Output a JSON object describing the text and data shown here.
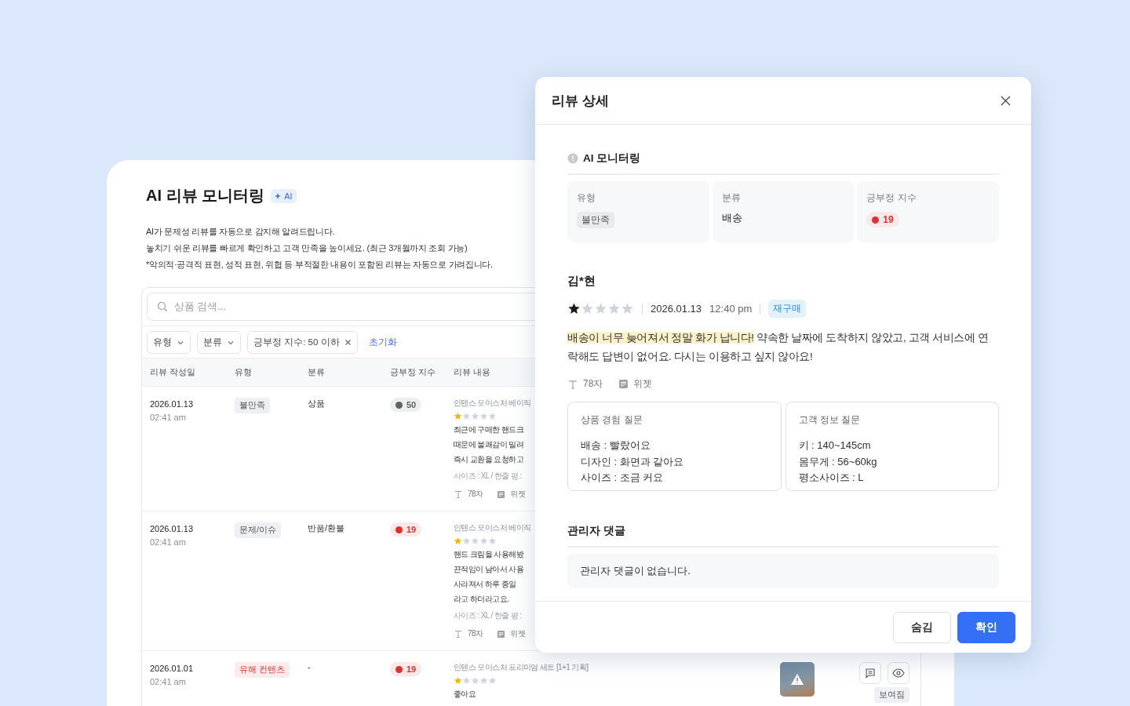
{
  "page": {
    "title": "AI 리뷰 모니터링",
    "badge": "AI",
    "description": [
      "AI가 문제성 리뷰를 자동으로 감지해 알려드립니다.",
      "놓치기 쉬운 리뷰를 빠르게 확인하고 고객 만족을 높이세요. (최근 3개월까지 조회 가능)",
      "*악의적·공격적 표현, 성적 표현, 위협 등 부적절한 내용이 포함된 리뷰는 자동으로 가려집니다."
    ]
  },
  "search": {
    "placeholder": "상품 검색..."
  },
  "filters": [
    {
      "kind": "dropdown",
      "label": "유형"
    },
    {
      "kind": "dropdown",
      "label": "분류"
    },
    {
      "kind": "chip",
      "label": "긍부정 지수: 50 이하"
    }
  ],
  "reset": "초기화",
  "table": {
    "columns": [
      "리뷰 작성일",
      "유형",
      "분류",
      "긍부정 지수",
      "리뷰 내용"
    ],
    "rows": [
      {
        "date": "2026.01.13",
        "time": "02:41 am",
        "type": {
          "label": "불만족",
          "kind": "neutral"
        },
        "category": "상품",
        "score": {
          "value": "50",
          "color": "#5f6368"
        },
        "product": "인텐스 모이스처 베이직",
        "stars": 1,
        "lines": [
          "최근에 구매한 핸드크",
          "때문에 불쾌감이 밀려",
          "즉시 교환을 요청하고"
        ],
        "option": "사이즈 : XL / 한줄 평 :",
        "length": "78자",
        "widget": "위젯"
      },
      {
        "date": "2026.01.13",
        "time": "02:41 am",
        "type": {
          "label": "문제/이슈",
          "kind": "neutral"
        },
        "category": "반품/환불",
        "score": {
          "value": "19",
          "color": "#e03131"
        },
        "product": "인텐스 모이스처 베이직",
        "stars": 1,
        "lines": [
          "핸드 크림을 사용해봤",
          "끈적임이 남아서 사용",
          "사라져서 하루 종일",
          "라고 하더라고요."
        ],
        "option": "사이즈 : XL / 한줄 평 :",
        "length": "78자",
        "widget": "위젯"
      },
      {
        "date": "2026.01.01",
        "time": "02:41 am",
        "type": {
          "label": "유해 컨텐츠",
          "kind": "harmful"
        },
        "category": "-",
        "score": {
          "value": "19",
          "color": "#e03131"
        },
        "product": "인텐스 모이스처 프리미엄 세트 [1+1 기획]",
        "stars": 1,
        "lines": [
          "좋아요"
        ],
        "status": "보여짐"
      }
    ]
  },
  "modal": {
    "title": "리뷰 상세",
    "section": "AI 모니터링",
    "cells": [
      {
        "kind": "tag",
        "label": "유형",
        "value": "불만족"
      },
      {
        "kind": "text",
        "label": "분류",
        "value": "배송"
      },
      {
        "kind": "score",
        "label": "긍부정 지수",
        "value": "19",
        "color": "#e03131"
      }
    ],
    "reviewer": "김*현",
    "stars": 1,
    "date": "2026.01.13",
    "time": "12:40 pm",
    "badge": "재구매",
    "highlight": "배송이 너무 늦어져서 정말 화가 납니다!",
    "text": "약속한 날짜에 도착하지 않았고, 고객 서비스에 연락해도 답변이 없어요. 다시는 이용하고 싶지 않아요!",
    "length": "78자",
    "widget": "위젯",
    "questions": [
      {
        "title": "상품 경험 질문",
        "items": [
          "배송 : 빨랐어요",
          "디자인 : 화면과 같아요",
          "사이즈 : 조금 커요"
        ]
      },
      {
        "title": "고객 정보 질문",
        "items": [
          "키 : 140~145cm",
          "몸무게 : 56~60kg",
          "평소사이즈 : L"
        ]
      }
    ],
    "comment_title": "관리자 댓글",
    "comment": "관리자 댓글이 없습니다.",
    "buttons": [
      {
        "label": "숨김",
        "kind": "secondary"
      },
      {
        "label": "확인",
        "kind": "primary"
      }
    ]
  }
}
